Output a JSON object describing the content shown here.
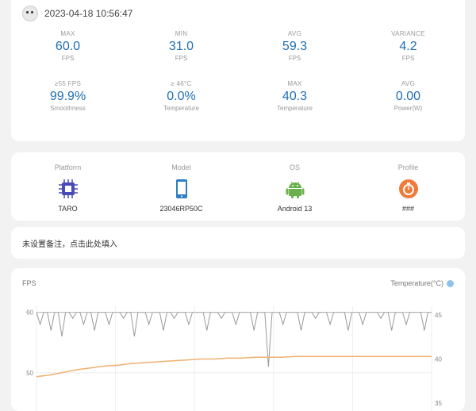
{
  "header": {
    "datetime": "2023-04-18 10:56:47"
  },
  "stats": [
    {
      "label": "MAX",
      "value": "60.0",
      "unit": "FPS"
    },
    {
      "label": "MIN",
      "value": "31.0",
      "unit": "FPS"
    },
    {
      "label": "AVG",
      "value": "59.3",
      "unit": "FPS"
    },
    {
      "label": "VARIANCE",
      "value": "4.2",
      "unit": "FPS"
    },
    {
      "label": "≥55 FPS",
      "value": "99.9%",
      "unit": "Smoothness"
    },
    {
      "label": "≥ 46°C",
      "value": "0.0%",
      "unit": "Temperature"
    },
    {
      "label": "MAX",
      "value": "40.3",
      "unit": "Temperature"
    },
    {
      "label": "AVG",
      "value": "0.00",
      "unit": "Power(W)"
    }
  ],
  "device": [
    {
      "label": "Platform",
      "value": "TARO",
      "icon": "chip-icon"
    },
    {
      "label": "Model",
      "value": "23046RP50C",
      "icon": "phone-icon"
    },
    {
      "label": "OS",
      "value": "Android 13",
      "icon": "android-icon"
    },
    {
      "label": "Profile",
      "value": "###",
      "icon": "profile-icon"
    }
  ],
  "note": {
    "placeholder": "未设置备注，点击此处填入"
  },
  "chart": {
    "fps_label": "FPS",
    "temp_label": "Temperature(°C)",
    "left_ticks": [
      "60",
      "50"
    ],
    "right_ticks": [
      "45",
      "40",
      "35"
    ],
    "colors": {
      "fps": "#9a9a9a",
      "temp": "#f0b070",
      "accent": "#1f6fb5"
    }
  },
  "chart_data": {
    "type": "line",
    "ylim_fps": [
      45,
      61
    ],
    "ylim_temp": [
      35,
      46
    ],
    "series": [
      {
        "name": "FPS",
        "values": [
          60,
          58,
          60,
          60,
          57,
          60,
          60,
          56,
          60,
          60,
          59,
          60,
          60,
          58,
          60,
          60,
          57,
          60,
          60,
          60,
          58,
          60,
          60,
          60,
          59,
          60,
          60,
          56,
          60,
          60,
          60,
          58,
          60,
          60,
          60,
          57,
          60,
          60,
          59,
          60,
          60,
          60,
          58,
          60,
          60,
          60,
          60,
          57,
          60,
          60,
          60,
          59,
          60,
          60,
          60,
          58,
          60,
          60,
          60,
          60,
          57,
          60,
          60,
          60,
          51,
          60,
          60,
          60,
          58,
          60,
          60,
          60,
          60,
          57,
          60,
          60,
          60,
          59,
          60,
          60,
          60,
          58,
          60,
          60,
          60,
          60,
          57,
          60,
          60,
          60,
          58,
          60,
          60,
          60,
          60,
          59,
          60,
          60,
          57,
          60,
          60,
          60,
          58,
          60,
          60,
          60,
          60,
          57,
          60,
          60
        ]
      },
      {
        "name": "Temperature(°C)",
        "values": [
          38,
          38.2,
          38.5,
          38.8,
          39,
          39.2,
          39.3,
          39.5,
          39.6,
          39.7,
          39.8,
          39.9,
          40,
          40,
          40.1,
          40.1,
          40.2,
          40.2,
          40.2,
          40.3,
          40.3,
          40.3,
          40.3,
          40.3,
          40.3,
          40.3,
          40.3,
          40.3,
          40.3,
          40.3
        ]
      }
    ]
  }
}
